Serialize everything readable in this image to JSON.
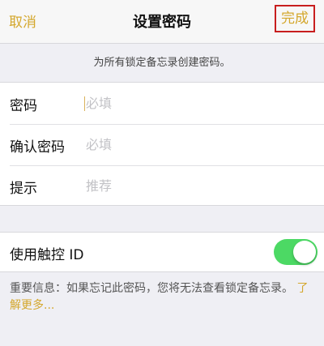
{
  "navbar": {
    "cancel_label": "取消",
    "title": "设置密码",
    "done_label": "完成"
  },
  "banner": {
    "text": "为所有锁定备忘录创建密码。"
  },
  "form": {
    "rows": [
      {
        "label": "密码",
        "placeholder": "必填",
        "value": ""
      },
      {
        "label": "确认密码",
        "placeholder": "必填",
        "value": ""
      },
      {
        "label": "提示",
        "placeholder": "推荐",
        "value": ""
      }
    ]
  },
  "touch_id": {
    "label": "使用触控 ID",
    "enabled": true
  },
  "note": {
    "text": "重要信息：如果忘记此密码，您将无法查看锁定备忘录。",
    "link": "了解更多..."
  },
  "colors": {
    "accent": "#d4a72c",
    "toggle_on": "#4cd964",
    "highlight_box": "#c81e1e",
    "background": "#efeff4"
  }
}
